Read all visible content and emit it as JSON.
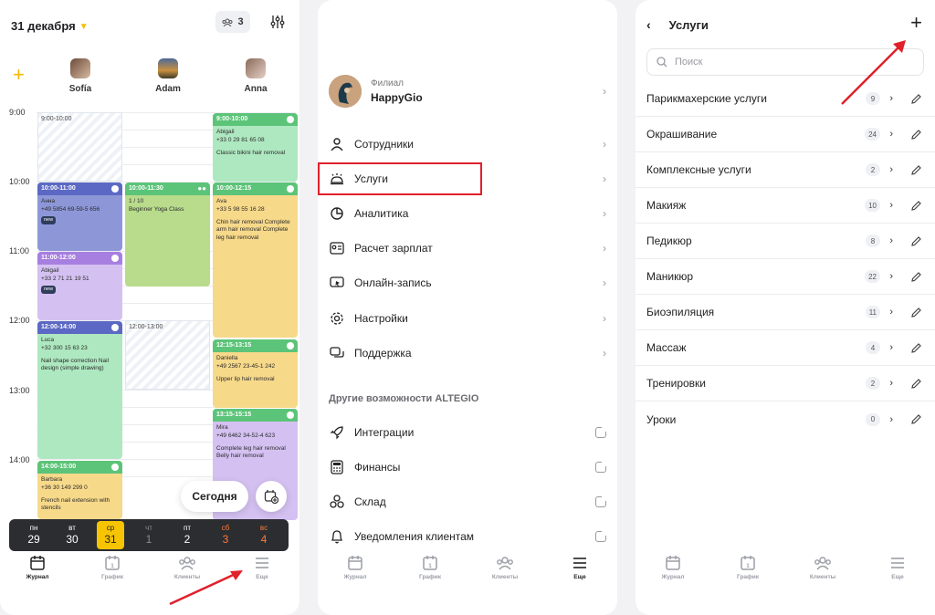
{
  "journal": {
    "date_title": "31 декабря",
    "group_count": "3",
    "staff": [
      {
        "name": "Sofía"
      },
      {
        "name": "Adam"
      },
      {
        "name": "Anna"
      }
    ],
    "times": [
      "9:00",
      "10:00",
      "11:00",
      "12:00",
      "13:00",
      "14:00"
    ],
    "blocked": [
      {
        "label": "9:00-10:00"
      },
      {
        "label": "12:00-13:00"
      }
    ],
    "events": [
      {
        "time": "10:00-11:00",
        "name": "Анна",
        "phone": "+49 5854 69-59-5 656",
        "service": "",
        "tag": "new"
      },
      {
        "time": "11:00-12:00",
        "name": "Abigail",
        "phone": "+33 2 71 21 19 51",
        "service": "",
        "tag": "new"
      },
      {
        "time": "12:00-14:00",
        "name": "Luca",
        "phone": "+32 300 15 63 23",
        "service": "Nail shape correction Nail design (simple drawing)",
        "tag": ""
      },
      {
        "time": "14:00-15:00",
        "name": "Barbara",
        "phone": "+36 30 149 299 0",
        "service": "French nail extension with stencils",
        "tag": ""
      },
      {
        "time": "10:00-11:30",
        "name": "1 / 10",
        "phone": "Beginner Yoga Class",
        "service": "",
        "tag": ""
      },
      {
        "time": "9:00-10:00",
        "name": "Abigail",
        "phone": "+33 0 29 81 65 08",
        "service": "Classic bikini hair removal",
        "tag": ""
      },
      {
        "time": "10:00-12:15",
        "name": "Ava",
        "phone": "+33 5 98 55 16 28",
        "service": "Chin hair removal Complete arm hair removal Complete leg hair removal",
        "tag": ""
      },
      {
        "time": "12:15-13:15",
        "name": "Daniella",
        "phone": "+49 2567 23-45-1 242",
        "service": "Upper lip hair removal",
        "tag": ""
      },
      {
        "time": "13:15-15:15",
        "name": "Mira",
        "phone": "+49 6462 34-52-4 623",
        "service": "Complete leg hair removal Belly hair removal",
        "tag": ""
      }
    ],
    "today_label": "Сегодня",
    "week": [
      {
        "dn": "пн",
        "dd": "29"
      },
      {
        "dn": "вт",
        "dd": "30"
      },
      {
        "dn": "ср",
        "dd": "31"
      },
      {
        "dn": "чт",
        "dd": "1"
      },
      {
        "dn": "пт",
        "dd": "2"
      },
      {
        "dn": "сб",
        "dd": "3"
      },
      {
        "dn": "вс",
        "dd": "4"
      }
    ]
  },
  "tabs": [
    {
      "label": "Журнал",
      "icon": "journal-icon"
    },
    {
      "label": "График",
      "icon": "schedule-icon"
    },
    {
      "label": "Клиенты",
      "icon": "clients-icon"
    },
    {
      "label": "Еще",
      "icon": "more-icon"
    }
  ],
  "menu": {
    "branch_caption": "Филиал",
    "branch_name": "HappyGio",
    "items": [
      {
        "label": "Сотрудники",
        "icon": "person-icon"
      },
      {
        "label": "Услуги",
        "icon": "service-bell-icon"
      },
      {
        "label": "Аналитика",
        "icon": "pie-chart-icon"
      },
      {
        "label": "Расчет зарплат",
        "icon": "payroll-icon"
      },
      {
        "label": "Онлайн-запись",
        "icon": "online-booking-icon"
      },
      {
        "label": "Настройки",
        "icon": "settings-icon"
      },
      {
        "label": "Поддержка",
        "icon": "chat-icon"
      }
    ],
    "section_title": "Другие возможности ALTEGIO",
    "extra": [
      {
        "label": "Интеграции",
        "icon": "rocket-icon"
      },
      {
        "label": "Финансы",
        "icon": "calculator-icon"
      },
      {
        "label": "Склад",
        "icon": "boxes-icon"
      },
      {
        "label": "Уведомления клиентам",
        "icon": "bell-icon"
      }
    ]
  },
  "services": {
    "title": "Услуги",
    "search_placeholder": "Поиск",
    "items": [
      {
        "name": "Парикмахерские услуги",
        "count": "9"
      },
      {
        "name": "Окрашивание",
        "count": "24"
      },
      {
        "name": "Комплексные услуги",
        "count": "2"
      },
      {
        "name": "Макияж",
        "count": "10"
      },
      {
        "name": "Педикюр",
        "count": "8"
      },
      {
        "name": "Маникюр",
        "count": "22"
      },
      {
        "name": "Биоэпиляция",
        "count": "11"
      },
      {
        "name": "Массаж",
        "count": "4"
      },
      {
        "name": "Тренировки",
        "count": "2"
      },
      {
        "name": "Уроки",
        "count": "0"
      }
    ]
  },
  "colors": {
    "accent": "#f6c400",
    "annotation": "#e0202a",
    "event_green": "#5cc479",
    "event_green_body": "#aee8c0",
    "event_blue": "#5b69c4",
    "event_blue_body": "#8d97d8",
    "event_purple": "#a77fe0",
    "event_purple_body": "#d4c1f2",
    "event_yellow_body": "#f7d98a",
    "event_lime_body": "#b8dc8c"
  }
}
